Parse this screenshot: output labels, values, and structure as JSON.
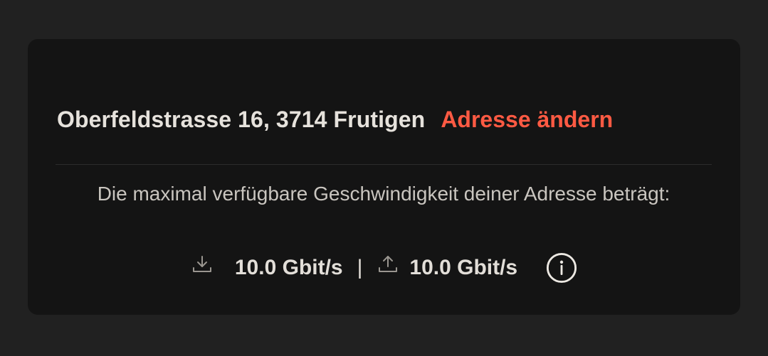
{
  "address": {
    "text": "Oberfeldstrasse 16, 3714 Frutigen",
    "change_label": "Adresse ändern"
  },
  "availability": {
    "text": "Die maximal verfügbare Geschwindigkeit deiner Adresse beträgt:"
  },
  "speeds": {
    "download_icon": "download-icon",
    "download": "10.0 Gbit/s",
    "separator": "|",
    "upload_icon": "upload-icon",
    "upload": "10.0 Gbit/s",
    "info_icon": "info-icon"
  },
  "colors": {
    "background": "#212121",
    "card": "#141414",
    "accent": "#ff5a43",
    "text": "#e6e2dc"
  }
}
